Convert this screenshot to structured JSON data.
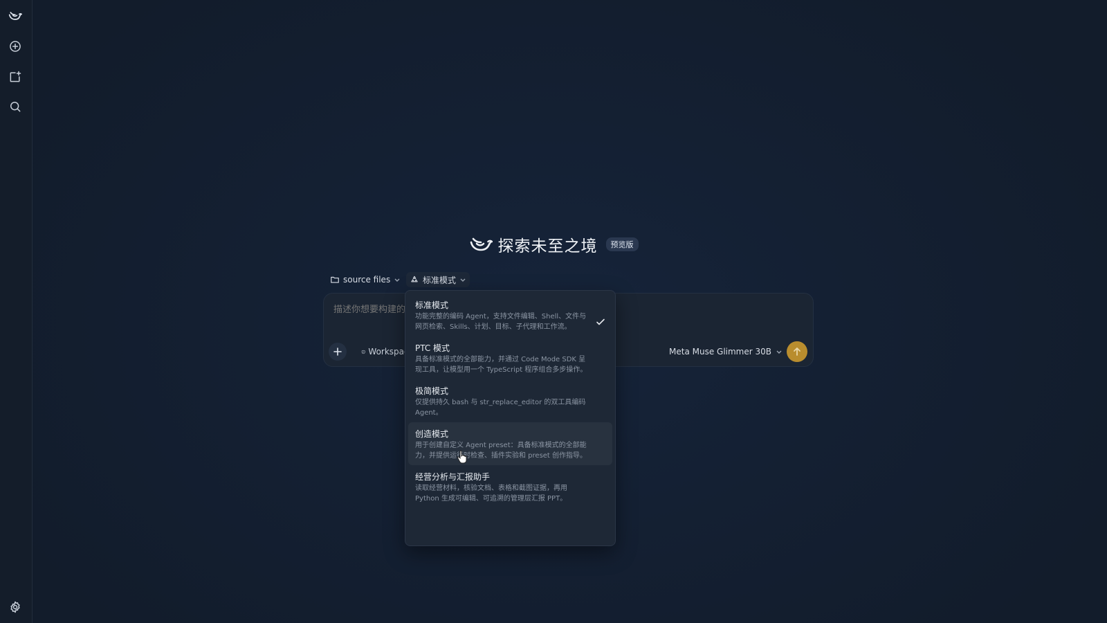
{
  "sidebar": {
    "items": [
      {
        "name": "logo",
        "icon": "whale-logo-icon"
      },
      {
        "name": "new-chat",
        "icon": "plus-circle-icon"
      },
      {
        "name": "new-project",
        "icon": "folder-plus-icon"
      },
      {
        "name": "search",
        "icon": "search-icon"
      }
    ],
    "settings_icon": "gear-icon"
  },
  "hero": {
    "title": "探索未至之境",
    "badge": "预览版"
  },
  "toolbar": {
    "folder_label": "source files",
    "mode_label": "标准模式"
  },
  "composer": {
    "placeholder": "描述你想要构建的",
    "workspace_label": "Workspace",
    "model_label": "Meta Muse Glimmer 30B"
  },
  "mode_menu": {
    "selected_index": 0,
    "hovered_index": 3,
    "items": [
      {
        "title": "标准模式",
        "desc": "功能完整的编码 Agent，支持文件编辑、Shell、文件与网页检索、Skills、计划、目标、子代理和工作流。"
      },
      {
        "title": "PTC 模式",
        "desc": "具备标准模式的全部能力，并通过 Code Mode SDK 呈现工具，让模型用一个 TypeScript 程序组合多步操作。"
      },
      {
        "title": "极简模式",
        "desc": "仅提供持久 bash 与 str_replace_editor 的双工具编码 Agent。"
      },
      {
        "title": "创造模式",
        "desc": "用于创建自定义 Agent preset：具备标准模式的全部能力，并提供运行时检查、插件实验和 preset 创作指导。"
      },
      {
        "title": "经营分析与汇报助手",
        "desc": "读取经营材料，核验文档、表格和截图证据，再用 Python 生成可编辑、可追溯的管理层汇报 PPT。"
      }
    ]
  },
  "colors": {
    "accent_send": "#b98d2e",
    "background": "#142033",
    "menu_bg": "#1e2836"
  }
}
